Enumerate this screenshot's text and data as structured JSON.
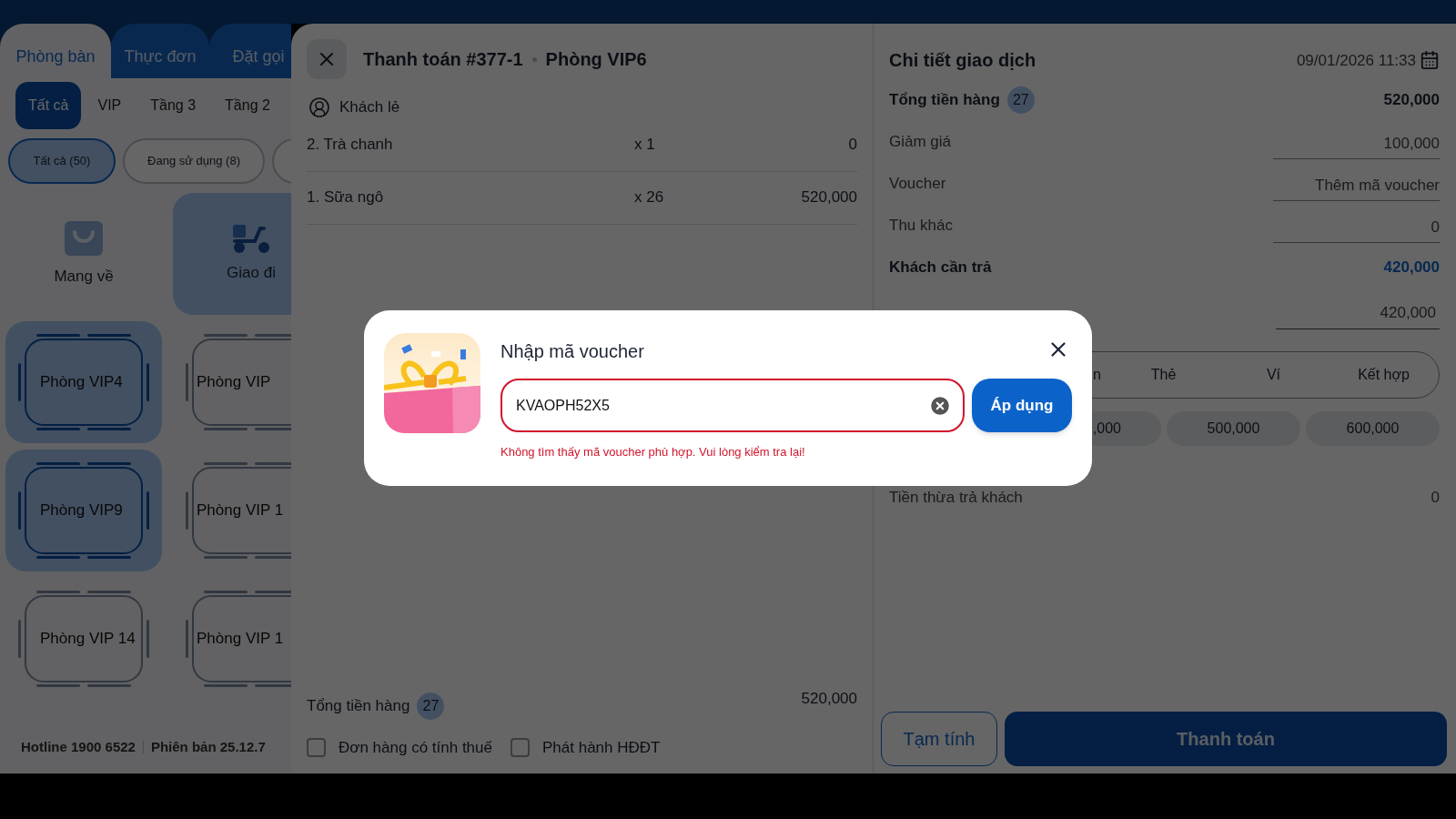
{
  "top_tabs": [
    {
      "label": "Phòng bàn",
      "selected": true
    },
    {
      "label": "Thực đơn",
      "selected": false
    },
    {
      "label": "Đặt gọi",
      "selected": false
    }
  ],
  "area_filters": [
    {
      "label": "Tất cả",
      "selected": true
    },
    {
      "label": "VIP",
      "selected": false
    },
    {
      "label": "Tầng 3",
      "selected": false
    },
    {
      "label": "Tầng 2",
      "selected": false
    }
  ],
  "status_filters": [
    {
      "label": "Tất cả (50)",
      "selected": true
    },
    {
      "label": "Đang sử dụng (8)",
      "selected": false
    }
  ],
  "order_types": [
    {
      "label": "Mang về",
      "kind": "bag",
      "selected": false
    },
    {
      "label": "Giao đi",
      "kind": "scooter",
      "selected": true
    }
  ],
  "rooms": [
    {
      "name": "Phòng VIP4",
      "selected": true
    },
    {
      "name": "Phòng VIP",
      "selected": false
    },
    {
      "name": "Phòng VIP9",
      "selected": true
    },
    {
      "name": "Phòng VIP 1",
      "selected": false
    },
    {
      "name": "Phòng VIP 14",
      "selected": false
    },
    {
      "name": "Phòng VIP 1",
      "selected": false
    }
  ],
  "footer": {
    "hotline": "Hotline 1900 6522",
    "version": "Phiên bản 25.12.7"
  },
  "payment": {
    "title": "Thanh toán #377-1",
    "room": "Phòng VIP6",
    "customer": "Khách lẻ",
    "items": [
      {
        "name": "2. Trà chanh",
        "qty": "x 1",
        "amount": "0"
      },
      {
        "name": "1. Sữa ngô",
        "qty": "x 26",
        "amount": "520,000"
      }
    ],
    "total_label": "Tổng tiền hàng",
    "total_count": "27",
    "total_amount": "520,000",
    "checkboxes": [
      {
        "label": "Đơn hàng có tính thuế",
        "checked": false
      },
      {
        "label": "Phát hành HĐĐT",
        "checked": false
      }
    ]
  },
  "details": {
    "title": "Chi tiết giao dịch",
    "datetime": "09/01/2026 11:33",
    "rows": [
      {
        "kind": "sum",
        "label": "Tổng tiền hàng",
        "count": "27",
        "value": "520,000"
      },
      {
        "kind": "input",
        "label": "Giảm giá",
        "value": "100,000"
      },
      {
        "kind": "input",
        "label": "Voucher",
        "value": "Thêm mã voucher"
      },
      {
        "kind": "input",
        "label": "Thu khác",
        "value": "0"
      },
      {
        "kind": "due",
        "label": "Khách cần trả",
        "value": "420,000"
      }
    ],
    "paid_value": "420,000",
    "methods": [
      "n",
      "Thẻ",
      "Ví",
      "Kết hợp"
    ],
    "quick_amounts": [
      ",000",
      "500,000",
      "600,000"
    ],
    "change_label": "Tiền thừa trả khách",
    "change_value": "0"
  },
  "actions": [
    {
      "kind": "secondary",
      "label": "Tạm tính"
    },
    {
      "kind": "primary",
      "label": "Thanh toán"
    }
  ],
  "voucher_dialog": {
    "title": "Nhập mã voucher",
    "code": "KVAOPH52X5",
    "apply_label": "Áp dụng",
    "error": "Không tìm thấy mã voucher phù hợp. Vui lòng kiểm tra lại!"
  }
}
